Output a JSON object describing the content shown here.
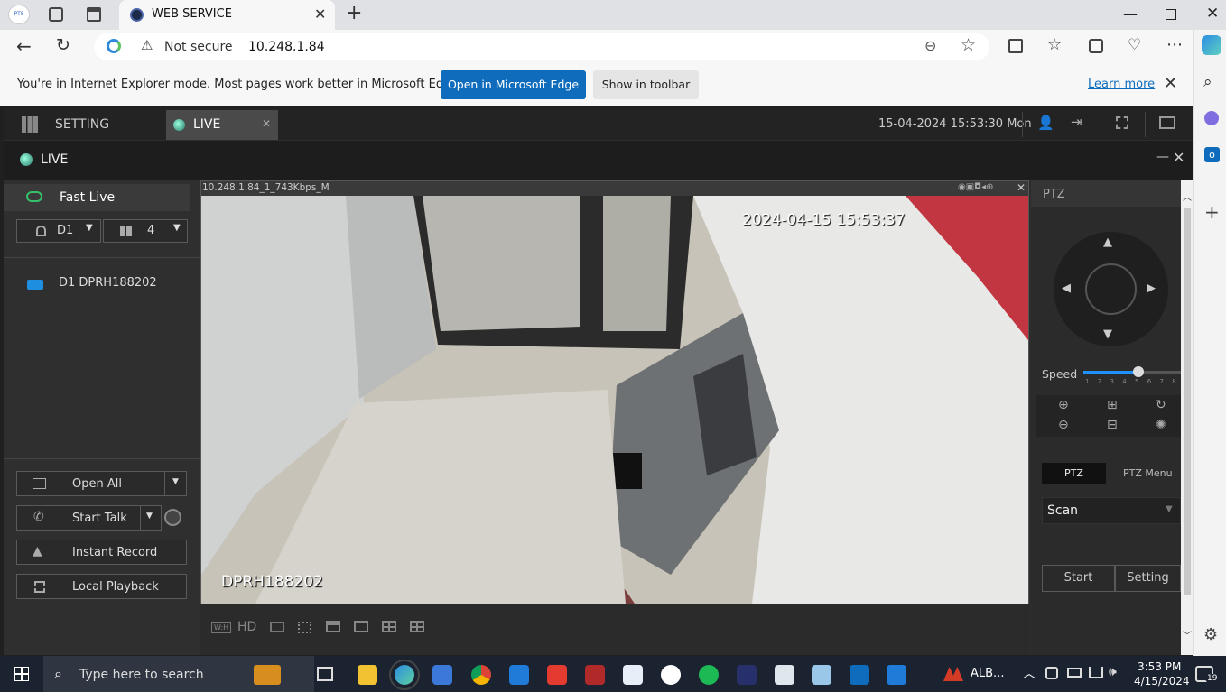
{
  "browser": {
    "tab_title": "WEB SERVICE",
    "url": "10.248.1.84",
    "not_secure": "Not secure",
    "ie_message": "You're in Internet Explorer mode. Most pages work better in Microsoft Edge.",
    "open_edge": "Open in Microsoft Edge",
    "show_toolbar": "Show in toolbar",
    "learn_more": "Learn more"
  },
  "app": {
    "setting_tab": "SETTING",
    "live_tab": "LIVE",
    "datetime": "15-04-2024 15:53:30 Mon",
    "live_title": "LIVE",
    "fast_live": "Fast Live",
    "device_select": "D1",
    "layout_select": "4",
    "device_item": "D1 DPRH188202",
    "open_all": "Open All",
    "start_talk": "Start Talk",
    "instant_record": "Instant Record",
    "local_playback": "Local Playback",
    "video_stream": "10.248.1.84_1_743Kbps_M",
    "video_timestamp": "2024-04-15 15:53:37",
    "video_channel": "DPRH188202",
    "hd_label": "HD",
    "wh_label": "W:H"
  },
  "ptz": {
    "title": "PTZ",
    "speed_label": "Speed",
    "speed_ticks": [
      "1",
      "2",
      "3",
      "4",
      "5",
      "6",
      "7",
      "8"
    ],
    "speed_value": 5,
    "tab_ptz": "PTZ",
    "tab_menu": "PTZ Menu",
    "scan_select": "Scan",
    "start": "Start",
    "setting": "Setting"
  },
  "taskbar": {
    "search_placeholder": "Type here to search",
    "tray_app": "ALB...",
    "time": "3:53 PM",
    "date": "4/15/2024",
    "notifications": "19"
  }
}
